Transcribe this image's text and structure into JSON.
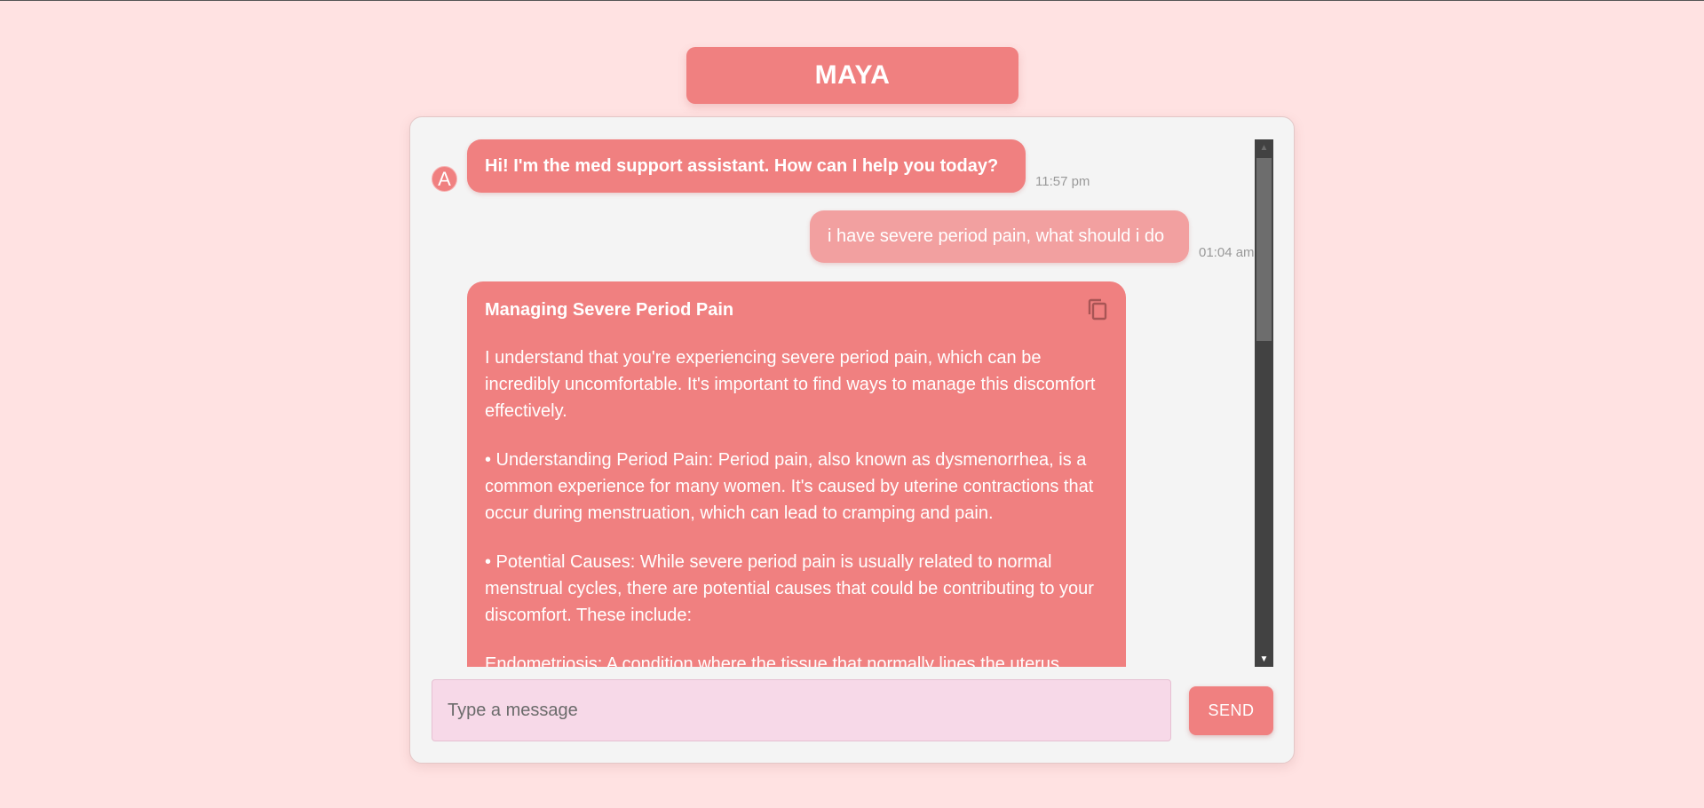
{
  "header": {
    "title": "MAYA"
  },
  "messages": {
    "bot_avatar_letter": "A",
    "greeting": {
      "text": "Hi! I'm the med support assistant. How can I help you today?",
      "time": "11:57 pm"
    },
    "user": {
      "text": "i have severe period pain, what should i do",
      "time": "01:04 am"
    },
    "response": {
      "title": "Managing Severe Period Pain",
      "paragraphs": [
        "I understand that you're experiencing severe period pain, which can be incredibly uncomfortable. It's important to find ways to manage this discomfort effectively.",
        "• Understanding Period Pain: Period pain, also known as dysmenorrhea, is a common experience for many women. It's caused by uterine contractions that occur during menstruation, which can lead to cramping and pain.",
        "• Potential Causes: While severe period pain is usually related to normal menstrual cycles, there are potential causes that could be contributing to your discomfort. These include:",
        "Endometriosis: A condition where the tissue that normally lines the uterus"
      ],
      "copy_icon": "copy-icon"
    }
  },
  "composer": {
    "placeholder": "Type a message",
    "value": "",
    "send_label": "SEND"
  },
  "colors": {
    "background": "#ffe2e2",
    "accent": "#f08080",
    "user_bubble": "#f2a0a0",
    "input_bg": "#f7d9e8"
  }
}
